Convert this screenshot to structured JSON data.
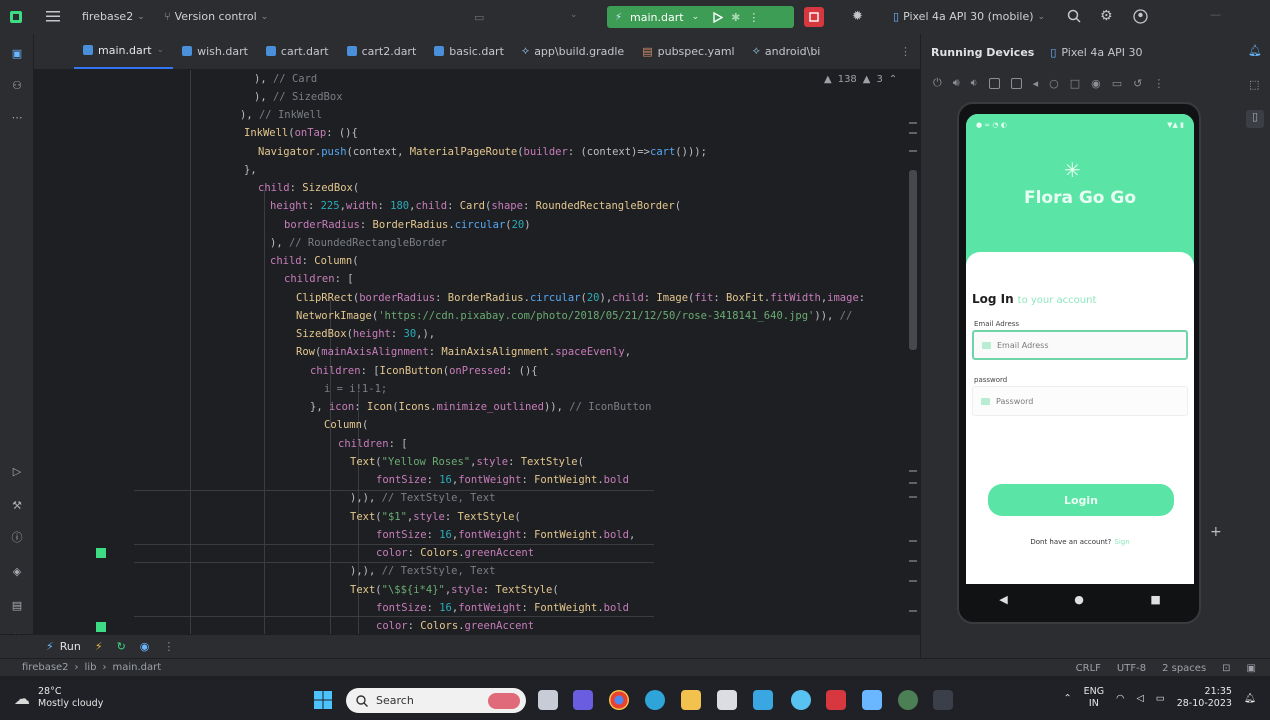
{
  "titlebar": {
    "project": "firebase2",
    "vcs": "Version control",
    "run_config": "main.dart",
    "device": "Pixel 4a API 30 (mobile)"
  },
  "tabs": [
    {
      "label": "main.dart",
      "active": true
    },
    {
      "label": "wish.dart",
      "active": false
    },
    {
      "label": "cart.dart",
      "active": false
    },
    {
      "label": "cart2.dart",
      "active": false
    },
    {
      "label": "basic.dart",
      "active": false
    },
    {
      "label": "app\\build.gradle",
      "active": false
    },
    {
      "label": "pubspec.yaml",
      "active": false
    },
    {
      "label": "android\\bi",
      "active": false
    }
  ],
  "editor": {
    "inspection_count": "138",
    "inspection_count2": "3"
  },
  "running_devices": {
    "title": "Running Devices",
    "device_tab": "Pixel 4a API 30"
  },
  "app": {
    "title": "Flora Go Go",
    "login_title": "Log In",
    "login_subtitle": "to your account",
    "email_label": "Email Adress",
    "email_placeholder": "Email Adress",
    "password_label": "password",
    "password_placeholder": "Password",
    "login_button": "Login",
    "signup_prompt": "Dont have an account?",
    "signup_link": "Sign"
  },
  "runbar": {
    "run_label": "Run"
  },
  "statusline": {
    "breadcrumb": [
      "firebase2",
      "lib",
      "main.dart"
    ],
    "line_ending": "CRLF",
    "encoding": "UTF-8",
    "indent": "2 spaces"
  },
  "taskbar": {
    "temperature": "28°C",
    "weather": "Mostly cloudy",
    "search_placeholder": "Search",
    "lang": "ENG",
    "region": "IN",
    "time": "21:35",
    "date": "28-10-2023"
  },
  "colors": {
    "accent_green": "#5ae5a6",
    "run_green": "#3d9d54",
    "stop_red": "#d7373f",
    "tab_blue": "#3574f0"
  }
}
